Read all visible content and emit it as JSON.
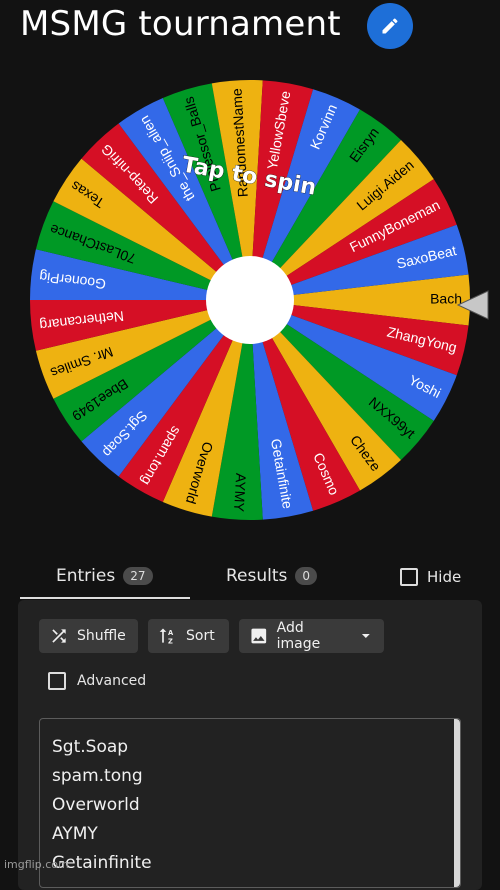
{
  "header": {
    "title": "MSMG tournament",
    "edit_icon": "pencil-icon"
  },
  "wheel": {
    "cta": "Tap to spin",
    "colors": [
      "#EEB211",
      "#D50F25",
      "#3369E8",
      "#009925"
    ],
    "entries": [
      "Bach",
      "ZhangYong",
      "Yoshi",
      "NXX99yt",
      "Cheze",
      "Cosmo",
      "Getainfinite",
      "AYMY",
      "Overworld",
      "spam.tong",
      "Sgt.Soap",
      "Bbee1949",
      "Mr. Smiles",
      "Nethercanarg",
      "GoonerPig",
      "70LastChance",
      "Texas",
      "Retep-nifriG",
      "the_Sniip_alien",
      "Professor_Balls",
      "RandomestName",
      "YellowSbeve",
      "Korvinn",
      "Eisryn",
      "Luigi.Aiden",
      "FunnyBoneman",
      "SaxoBeat"
    ],
    "pointer_icon": "triangle-pointer-icon"
  },
  "tabs": [
    {
      "label": "Entries",
      "count": "27"
    },
    {
      "label": "Results",
      "count": "0"
    }
  ],
  "hide_label": "Hide",
  "toolbar": {
    "shuffle_label": "Shuffle",
    "sort_label": "Sort",
    "add_image_label": "Add image",
    "shuffle_icon": "shuffle-icon",
    "sort_icon": "sort-icon",
    "image_icon": "image-icon",
    "dropdown_icon": "chevron-down-icon"
  },
  "advanced_label": "Advanced",
  "entry_lines": [
    "Sgt.Soap",
    "spam.tong",
    "Overworld",
    "AYMY",
    "Getainfinite"
  ],
  "watermark": "imgflip.com"
}
